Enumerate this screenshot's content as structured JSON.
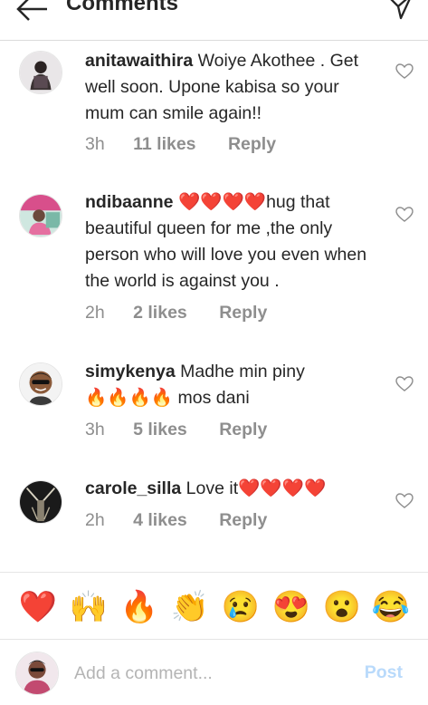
{
  "header": {
    "title": "Comments",
    "back_icon": "arrow-left-icon",
    "share_icon": "send-icon"
  },
  "comments": [
    {
      "username": "anitawaithira",
      "text": "Woiye Akothee . Get well soon. Upone kabisa so your mum can smile again!!",
      "time": "3h",
      "likes": "11 likes",
      "reply": "Reply"
    },
    {
      "username": "ndibaanne",
      "emoji": "❤️❤️❤️❤️",
      "text": "hug that beautiful queen for me ,the only person who will love you even when the world is against you .",
      "time": "2h",
      "likes": "2 likes",
      "reply": "Reply"
    },
    {
      "username": "simykenya",
      "text": "Madhe min piny",
      "emoji": "🔥🔥🔥🔥",
      "text2": "mos dani",
      "time": "3h",
      "likes": "5 likes",
      "reply": "Reply"
    },
    {
      "username": "carole_silla",
      "text": "Love it",
      "emoji": "❤️❤️❤️❤️",
      "time": "2h",
      "likes": "4 likes",
      "reply": "Reply"
    }
  ],
  "emoji_bar": [
    "❤️",
    "🙌",
    "🔥",
    "👏",
    "😢",
    "😍",
    "😮",
    "😂"
  ],
  "compose": {
    "placeholder": "Add a comment...",
    "post_label": "Post"
  }
}
